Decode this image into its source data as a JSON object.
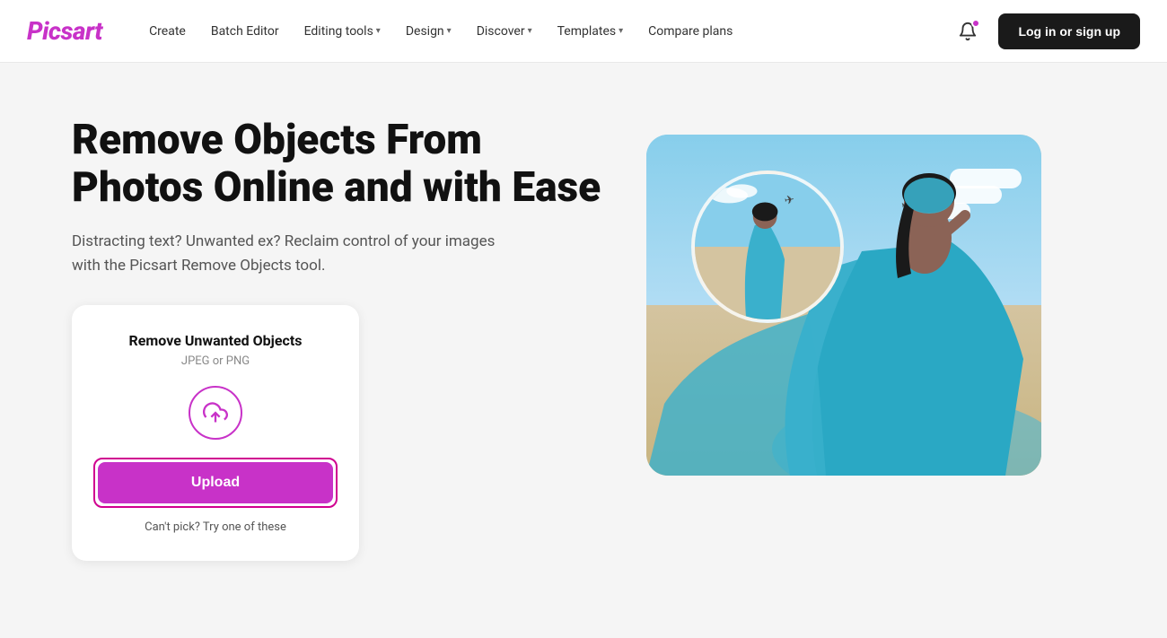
{
  "header": {
    "logo": "Picsart",
    "nav": [
      {
        "label": "Create",
        "hasDropdown": false
      },
      {
        "label": "Batch Editor",
        "hasDropdown": false
      },
      {
        "label": "Editing tools",
        "hasDropdown": true
      },
      {
        "label": "Design",
        "hasDropdown": true
      },
      {
        "label": "Discover",
        "hasDropdown": true
      },
      {
        "label": "Templates",
        "hasDropdown": true
      },
      {
        "label": "Compare plans",
        "hasDropdown": false
      }
    ],
    "loginButton": "Log in or sign up"
  },
  "hero": {
    "title": "Remove Objects From Photos Online and with Ease",
    "subtitle": "Distracting text? Unwanted ex? Reclaim control of your images with the Picsart Remove Objects tool."
  },
  "uploadCard": {
    "title": "Remove Unwanted Objects",
    "subtitle": "JPEG or PNG",
    "uploadButton": "Upload",
    "cantPickText": "Can't pick? Try one of these"
  }
}
